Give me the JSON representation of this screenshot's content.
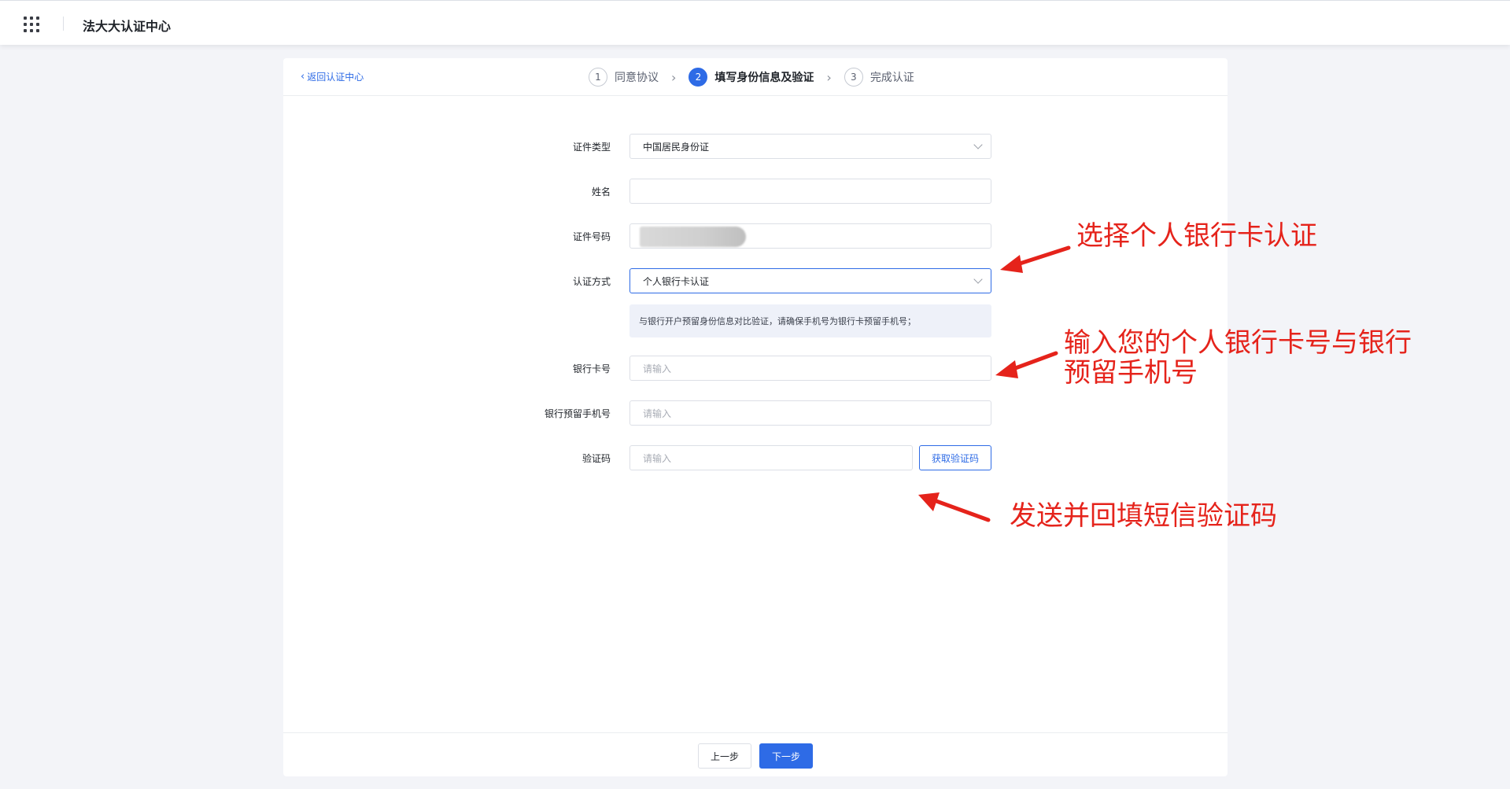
{
  "header": {
    "app_title": "法大大认证中心",
    "apps_icon": "grid-apps-icon"
  },
  "card": {
    "back_link": "返回认证中心",
    "steps": [
      {
        "num": "1",
        "label": "同意协议",
        "state": "done"
      },
      {
        "num": "2",
        "label": "填写身份信息及验证",
        "state": "active"
      },
      {
        "num": "3",
        "label": "完成认证",
        "state": "pending"
      }
    ]
  },
  "form": {
    "id_type": {
      "label": "证件类型",
      "value": "中国居民身份证"
    },
    "name": {
      "label": "姓名",
      "value": ""
    },
    "id_number": {
      "label": "证件号码",
      "value": ""
    },
    "auth_method": {
      "label": "认证方式",
      "value": "个人银行卡认证"
    },
    "hint": "与银行开户预留身份信息对比验证，请确保手机号为银行卡预留手机号；",
    "bank_card": {
      "label": "银行卡号",
      "placeholder": "请输入"
    },
    "bank_phone": {
      "label": "银行预留手机号",
      "placeholder": "请输入"
    },
    "sms_code": {
      "label": "验证码",
      "placeholder": "请输入",
      "button": "获取验证码"
    }
  },
  "footer": {
    "prev": "上一步",
    "next": "下一步"
  },
  "annotations": {
    "a1": "选择个人银行卡认证",
    "a2_line1": "输入您的个人银行卡号与银行",
    "a2_line2": "预留手机号",
    "a3": "发送并回填短信验证码"
  },
  "colors": {
    "primary": "#2e6be6",
    "annotation_red": "#e5231b"
  }
}
